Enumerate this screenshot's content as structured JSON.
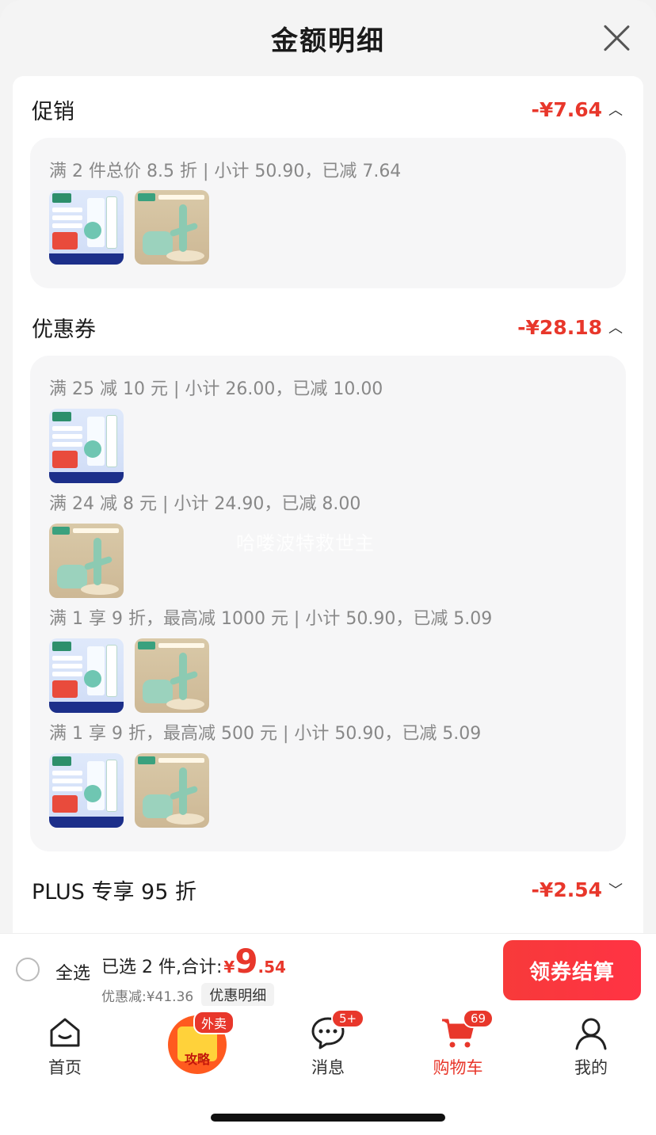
{
  "header": {
    "title": "金额明细"
  },
  "promotion": {
    "title": "促销",
    "amount": "-¥7.64",
    "rule": "满 2 件总价 8.5 折 | 小计 50.90，已减 7.64"
  },
  "coupon": {
    "title": "优惠券",
    "amount": "-¥28.18",
    "rules": [
      "满 25 减 10 元 | 小计 26.00，已减 10.00",
      "满 24 减 8 元 | 小计 24.90，已减 8.00",
      "满 1 享 9 折，最高减 1000 元 | 小计 50.90，已减 5.09",
      "满 1 享 9 折，最高减 500 元 | 小计 50.90，已减 5.09"
    ],
    "watermark": "哈喽波特救世主"
  },
  "plus": {
    "title": "PLUS 专享 95 折",
    "amount": "-¥2.54"
  },
  "checkout": {
    "select_all": "全选",
    "summary_label": "已选 2 件,合计:",
    "currency": "¥",
    "total_int": "9",
    "total_dec": ".54",
    "discount": "优惠减:¥41.36",
    "detail_label": "优惠明细",
    "pay_label": "领券结算"
  },
  "tabs": [
    {
      "label": "首页",
      "icon": "home-icon"
    },
    {
      "label": "外卖",
      "icon": "promo-icon",
      "inner": "攻略"
    },
    {
      "label": "消息",
      "icon": "message-icon",
      "badge": "5+"
    },
    {
      "label": "购物车",
      "icon": "cart-icon",
      "badge": "69",
      "active": true
    },
    {
      "label": "我的",
      "icon": "user-icon"
    }
  ],
  "colors": {
    "accent": "#e8372b",
    "text": "#1a1a1a",
    "muted": "#888888"
  }
}
